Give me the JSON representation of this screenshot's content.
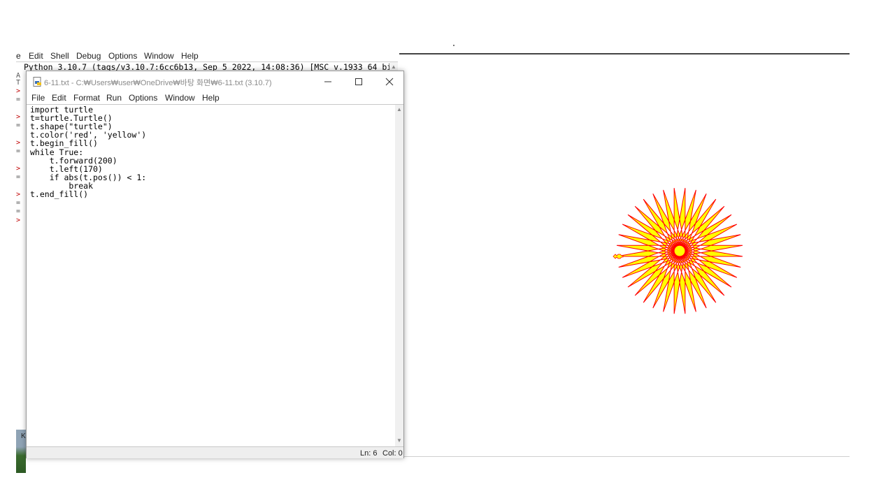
{
  "shell": {
    "menu": [
      "e",
      "Edit",
      "Shell",
      "Debug",
      "Options",
      "Window",
      "Help"
    ],
    "banner": "Python 3.10.7 (tags/v3.10.7:6cc6b13, Sep  5 2022, 14:08:36) [MSC v.1933 64 bit (",
    "gutter_glyphs": [
      "A",
      "T",
      ">",
      "=",
      ">",
      "=",
      ">",
      "=",
      ">",
      "=",
      ">",
      "=",
      "=",
      ">"
    ]
  },
  "editor": {
    "title": "6-11.txt - C:₩Users₩user₩OneDrive₩바탕 화면₩6-11.txt (3.10.7)",
    "menu": [
      "File",
      "Edit",
      "Format",
      "Run",
      "Options",
      "Window",
      "Help"
    ],
    "code_lines": [
      "import turtle",
      "t=turtle.Turtle()",
      "t.shape(\"turtle\")",
      "t.color('red', 'yellow')",
      "t.begin_fill()",
      "while True:",
      "    t.forward(200)",
      "    t.left(170)",
      "    if abs(t.pos()) < 1:",
      "        break",
      "t.end_fill()"
    ],
    "status": {
      "ln": "Ln: 6",
      "col": "Col: 0"
    },
    "window_controls": [
      "minimize-icon",
      "maximize-icon",
      "close-icon"
    ]
  },
  "turtle_drawing": {
    "forward": 200,
    "left_angle": 170,
    "pen_color": "#ff0000",
    "fill_color": "#ffff00",
    "turtle_shape": "turtle"
  },
  "colors": {
    "prompt": "#c00000",
    "title_text": "#8a8a8a"
  }
}
